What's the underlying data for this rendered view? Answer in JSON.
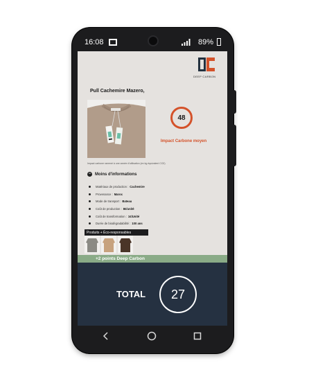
{
  "status_bar": {
    "time": "16:08",
    "battery": "89%"
  },
  "app": {
    "logo_text": "DEEP CARBON",
    "product_title": "Pull Cachemire Mazero,",
    "score": "48",
    "impact_label": "Impact Carbone moyen",
    "impact_note": "Impact carbone ramené à une année d'utilisation (en kg équivalent CO2)",
    "less_info_label": "Moins d'informations",
    "details": [
      {
        "label": "Matériaux de production :",
        "value": "Cachemire"
      },
      {
        "label": "Provenance :",
        "value": "Maroc"
      },
      {
        "label": "Mode de transport :",
        "value": "Bateau"
      },
      {
        "label": "Coût de production :",
        "value": "8€/unité"
      },
      {
        "label": "Coût de transformation :",
        "value": "1€/Unité"
      },
      {
        "label": "Durée de biodégradabilité :",
        "value": "100 ans"
      }
    ],
    "eco_label": "Produits + Éco-responsables",
    "points_banner": "+2 points Deep Carbon",
    "total_label": "TOTAL",
    "total_value": "27"
  },
  "colors": {
    "accent": "#d4522a",
    "panel": "#253141",
    "points_green": "#8aab87",
    "screen_bg": "#e5e2df"
  },
  "icons": [
    "wifi-signal-icon",
    "battery-icon",
    "front-camera-icon",
    "back-nav-icon",
    "home-nav-icon",
    "recents-nav-icon"
  ]
}
